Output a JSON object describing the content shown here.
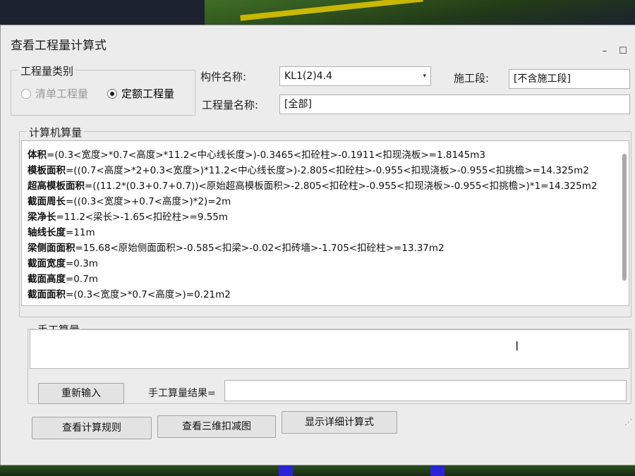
{
  "dialog": {
    "title": "查看工程量计算式",
    "minimize_icon": "minimize-icon",
    "maximize_icon": "maximize-icon"
  },
  "quantity_category": {
    "group_label": "工程量类别",
    "option_list": "清单工程量",
    "option_quota": "定额工程量",
    "selected": "定额工程量"
  },
  "component": {
    "name_label": "构件名称:",
    "name_value": "KL1(2)4.4",
    "section_label": "施工段:",
    "section_value": "[不含施工段]",
    "quantity_name_label": "工程量名称:",
    "quantity_name_value": "[全部]"
  },
  "computer_calc": {
    "group_label": "计算机算量",
    "lines": [
      {
        "name": "体积",
        "expr": "=(0.3<宽度>*0.7<高度>*11.2<中心线长度>)-0.3465<扣砼柱>-0.1911<扣现浇板>=1.8145m3"
      },
      {
        "name": "模板面积",
        "expr": "=((0.7<高度>*2+0.3<宽度>)*11.2<中心线长度>)-2.805<扣砼柱>-0.955<扣现浇板>-0.955<扣挑檐>=14.325m2"
      },
      {
        "name": "超高模板面积",
        "expr": "=((11.2*(0.3+0.7+0.7))<原始超高模板面积>-2.805<扣砼柱>-0.955<扣现浇板>-0.955<扣挑檐>)*1=14.325m2"
      },
      {
        "name": "截面周长",
        "expr": "=((0.3<宽度>+0.7<高度>)*2)=2m"
      },
      {
        "name": "梁净长",
        "expr": "=11.2<梁长>-1.65<扣砼柱>=9.55m"
      },
      {
        "name": "轴线长度",
        "expr": "=11m"
      },
      {
        "name": "梁侧面面积",
        "expr": "=15.68<原始侧面面积>-0.585<扣梁>-0.02<扣砖墙>-1.705<扣砼柱>=13.37m2"
      },
      {
        "name": "截面宽度",
        "expr": "=0.3m"
      },
      {
        "name": "截面高度",
        "expr": "=0.7m"
      },
      {
        "name": "截面面积",
        "expr": "=(0.3<宽度>*0.7<高度>)=0.21m2"
      }
    ]
  },
  "manual_calc": {
    "group_label": "手工算量",
    "reenter_button": "重新输入",
    "result_label": "手工算量结果=",
    "result_value": ""
  },
  "footer": {
    "rules_button": "查看计算规则",
    "view3d_button": "查看三维扣减图",
    "detail_button": "显示详细计算式"
  },
  "colors": {
    "dialog_bg": "#ececec",
    "scene_bg": "#1c2230",
    "scene_green": "#4a7d2c",
    "scene_blue": "#2a22d8",
    "scene_yellow": "#c8b800"
  }
}
